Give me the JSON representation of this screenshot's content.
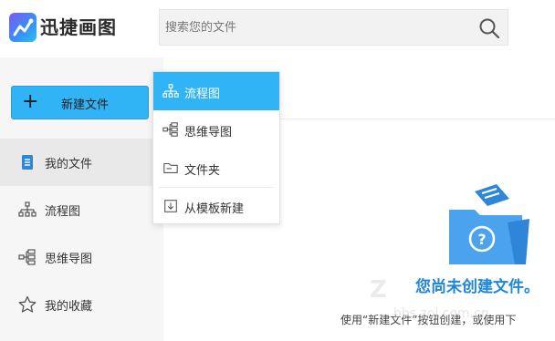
{
  "app": {
    "name": "迅捷画图"
  },
  "search": {
    "placeholder": "搜索您的文件"
  },
  "sidebar": {
    "new_button_label": "新建文件",
    "items": [
      {
        "label": "我的文件",
        "icon": "file-icon",
        "active": true
      },
      {
        "label": "流程图",
        "icon": "flowchart-icon",
        "active": false
      },
      {
        "label": "思维导图",
        "icon": "mindmap-icon",
        "active": false
      },
      {
        "label": "我的收藏",
        "icon": "star-icon",
        "active": false
      }
    ]
  },
  "dropdown": {
    "items": [
      {
        "label": "流程图",
        "icon": "flowchart-icon",
        "active": true
      },
      {
        "label": "思维导图",
        "icon": "mindmap-icon",
        "active": false
      },
      {
        "label": "文件夹",
        "icon": "folder-icon",
        "active": false
      },
      {
        "label": "从模板新建",
        "icon": "template-icon",
        "active": false
      }
    ]
  },
  "empty_state": {
    "title": "您尚未创建文件。",
    "hint": "使用“新建文件”按钮创建，或使用下"
  },
  "colors": {
    "accent": "#30b4f5",
    "empty_title": "#1f87d6"
  }
}
